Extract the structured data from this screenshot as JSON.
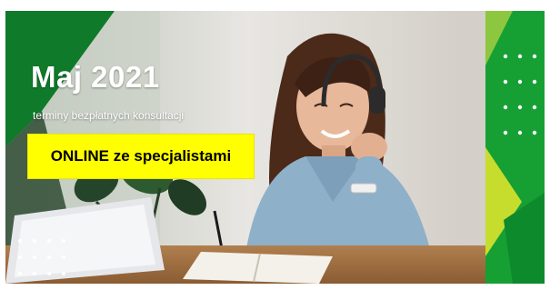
{
  "banner": {
    "title": "Maj 2021",
    "subtitle": "terminy bezpłatnych konsultacji",
    "cta_label": "ONLINE ze specjalistami"
  },
  "colors": {
    "brand_green": "#16a034",
    "light_green": "#8dc63f",
    "highlight_yellow": "#ffff00",
    "text_white": "#ffffff"
  },
  "icons": [
    "dot-grid-pattern",
    "plant-decoration",
    "laptop-illustration",
    "headphones-illustration"
  ]
}
